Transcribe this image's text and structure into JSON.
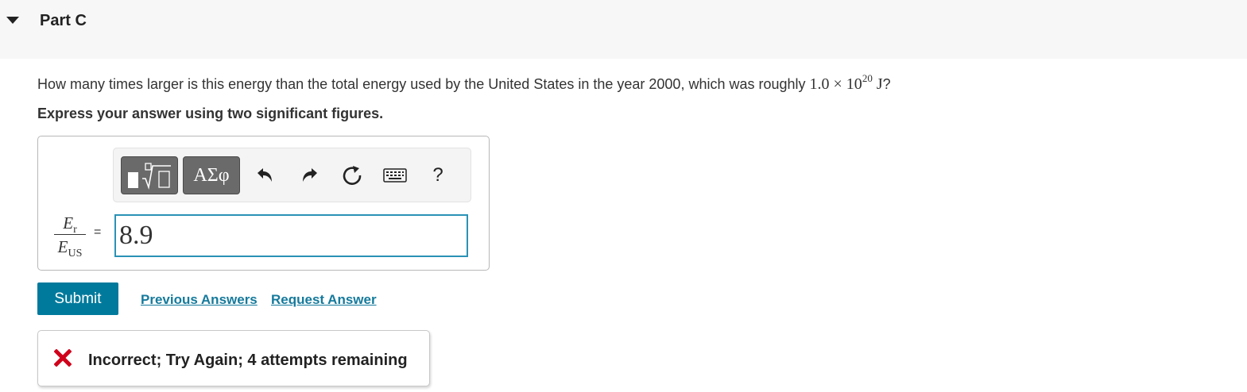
{
  "part": {
    "title": "Part C"
  },
  "question": {
    "text_before": "How many times larger is this energy than the total energy used by the United States in the year 2000, which was roughly ",
    "math_base": "1.0 × 10",
    "math_exp": "20",
    "math_unit": " J",
    "text_after": "?"
  },
  "instruction": "Express your answer using two significant figures.",
  "toolbar": {
    "templates_icon": "templates-sqrt-icon",
    "greek_label": "ΑΣφ",
    "undo_icon": "undo-icon",
    "redo_icon": "redo-icon",
    "reset_icon": "reset-icon",
    "keyboard_icon": "keyboard-icon",
    "help_label": "?"
  },
  "equation": {
    "numerator_var": "E",
    "numerator_sub": "r",
    "denominator_var": "E",
    "denominator_sub": "US",
    "equals": "="
  },
  "answer": {
    "value": "8.9"
  },
  "actions": {
    "submit_label": "Submit",
    "previous_answers_label": "Previous Answers",
    "request_answer_label": "Request Answer"
  },
  "feedback": {
    "icon": "incorrect-x-icon",
    "message": "Incorrect; Try Again; 4 attempts remaining",
    "color": "#d0021b"
  },
  "colors": {
    "accent": "#007a9c",
    "input_border": "#2a92b5",
    "link": "#157a9c"
  }
}
